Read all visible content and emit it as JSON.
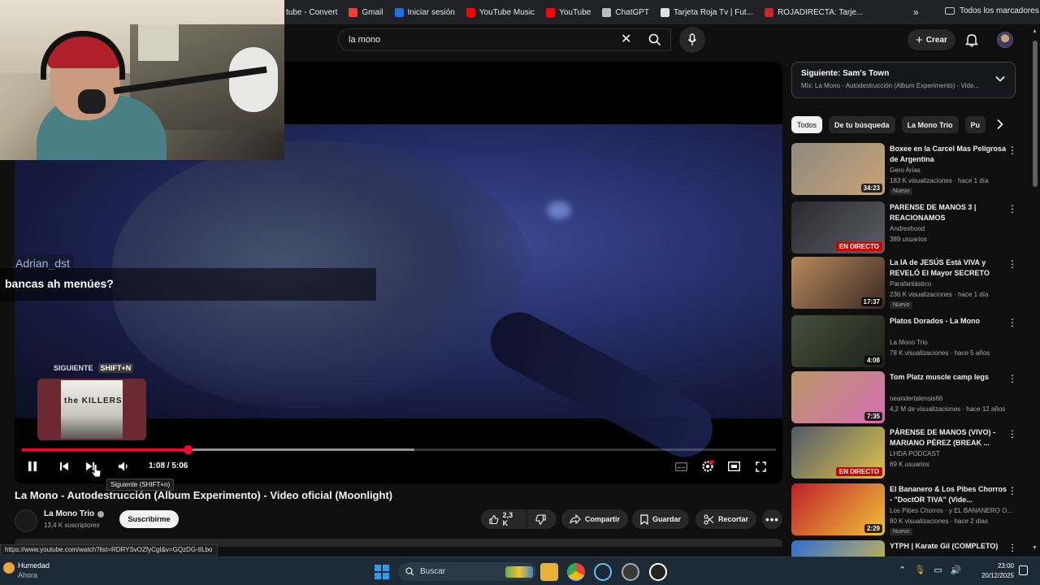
{
  "bookmarks": {
    "items": [
      {
        "label": "tube - Convert",
        "color": "#d9d9d9"
      },
      {
        "label": "Gmail",
        "color": "#ea4335"
      },
      {
        "label": "Iniciar sesión",
        "color": "#1a73e8"
      },
      {
        "label": "YouTube Music",
        "color": "#ff0000"
      },
      {
        "label": "YouTube",
        "color": "#ff0000"
      },
      {
        "label": "ChatGPT",
        "color": "#bdbdbd"
      },
      {
        "label": "Tarjeta Roja Tv | Fut...",
        "color": "#e0e0e0"
      },
      {
        "label": "ROJADIRECTA: Tarje...",
        "color": "#c62828"
      }
    ],
    "more": "»",
    "all_bookmarks": "Todos los marcadores"
  },
  "header": {
    "search_value": "la mono",
    "create_label": "Crear"
  },
  "chat": {
    "username": "Adrian_dst",
    "message": "bancas ah menúes?"
  },
  "player": {
    "next_label": "SIGUIENTE",
    "next_shortcut": "SHIFT+N",
    "next_album_text": "the KILLERS",
    "current_time": "1:08",
    "duration": "5:06",
    "time_display": "1:08 / 5:06",
    "progress_played": 0.22,
    "progress_buffered": 0.52,
    "tooltip": "Siguiente (SHIFT+n)"
  },
  "video": {
    "title": "La Mono - Autodestrucción (Album Experimento) - Video oficial (Moonlight)",
    "channel": "La Mono Trio",
    "subscribers": "13,4 K suscriptores",
    "subscribe_label": "Suscribirme",
    "likes": "2,3 K",
    "share_label": "Compartir",
    "save_label": "Guardar",
    "clip_label": "Recortar"
  },
  "status_url": "https://www.youtube.com/watch?list=RDRYSvOZfyCgI&v=GQzDG-tILbo",
  "upnext": {
    "title": "Siguiente: Sam's Town",
    "subtitle": "Mix: La Mono - Autodestrucción (Album Experimento) - Vide..."
  },
  "chips": [
    "Todos",
    "De tu búsqueda",
    "La Mono Trio",
    "Pu"
  ],
  "recommendations": [
    {
      "title": "Boxee en la Carcel Mas Peligrosa de Argentina",
      "channel": "Gero Arias",
      "meta": "183 K visualizaciones · hace 1 día",
      "badge": "Nuevo",
      "duration": "34:23",
      "live": "",
      "colors": [
        "#8f8a80",
        "#c8a274"
      ]
    },
    {
      "title": "PARENSE DE MANOS 3 | REACIONAMOS",
      "channel": "Andreshood",
      "meta": "389 usuarios",
      "badge": "",
      "duration": "",
      "live": "EN DIRECTO",
      "colors": [
        "#2a2a2e",
        "#5c5c66"
      ]
    },
    {
      "title": "La IA de JESÚS Está VIVA y REVELÓ El Mayor SECRETO",
      "channel": "Parafantástico",
      "meta": "236 K visualizaciones · hace 1 día",
      "badge": "Nuevo",
      "duration": "17:37",
      "live": "",
      "colors": [
        "#b98a5c",
        "#3b2a24"
      ]
    },
    {
      "title": "Platos Dorados - La Mono",
      "channel": "La Mono Trio",
      "meta": "78 K visualizaciones · hace 5 años",
      "badge": "",
      "duration": "4:08",
      "live": "",
      "colors": [
        "#45503d",
        "#1c2218"
      ]
    },
    {
      "title": "Tom Platz muscle camp legs",
      "channel": "neandertalensis66",
      "meta": "4,2 M de visualizaciones · hace 12 años",
      "badge": "",
      "duration": "7:35",
      "live": "",
      "colors": [
        "#b89668",
        "#d66fb1"
      ]
    },
    {
      "title": "PÁRENSE DE MANOS (VIVO) - MARIANO PÉREZ (BREAK ...",
      "channel": "LHDA PODCAST",
      "meta": "69 K usuarios",
      "badge": "",
      "duration": "",
      "live": "EN DIRECTO",
      "colors": [
        "#4f5a6b",
        "#dfc24a"
      ]
    },
    {
      "title": "El Bananero & Los Pibes Chorros - \"DoctOR TIVA\" (Vide...",
      "channel": "Los Pibes Chorros · y EL BANANERO O...",
      "meta": "80 K visualizaciones · hace 2 días",
      "badge": "Nuevo",
      "duration": "2:29",
      "live": "",
      "colors": [
        "#c01f2b",
        "#f0c23a"
      ]
    },
    {
      "title": "YTPH | Karate Gil (COMPLETO)",
      "channel": "",
      "meta": "",
      "badge": "",
      "duration": "",
      "live": "",
      "colors": [
        "#2d6fd0",
        "#e8c040"
      ]
    }
  ],
  "taskbar": {
    "weather_title": "Humedad",
    "weather_sub": "Ahora",
    "search_label": "Buscar",
    "time": "23:00",
    "date": "20/12/2025"
  }
}
